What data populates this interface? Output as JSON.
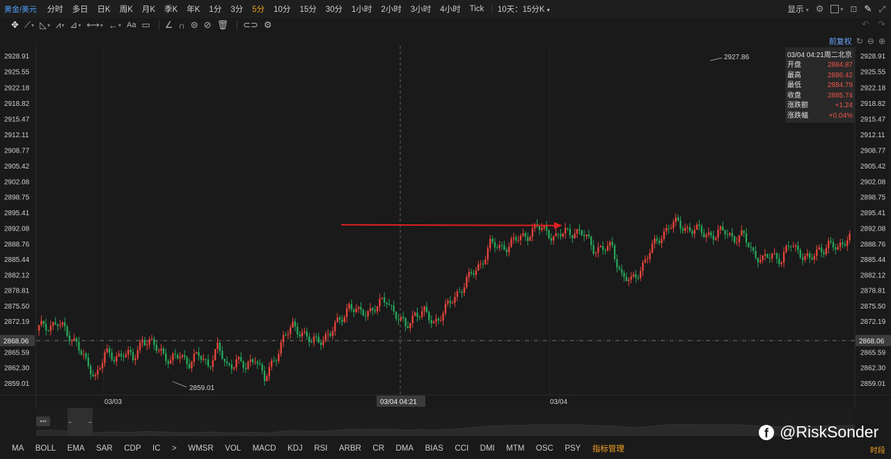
{
  "topbar": {
    "symbol": "黄金/美元",
    "periods": [
      "分时",
      "多日",
      "日K",
      "周K",
      "月K",
      "季K",
      "年K",
      "1分",
      "3分",
      "5分",
      "10分",
      "15分",
      "30分",
      "1小时",
      "2小时",
      "3小时",
      "4小时",
      "Tick"
    ],
    "active_period": "5分",
    "multi_view": "10天：15分K",
    "display_label": "显示"
  },
  "chart_header": {
    "fq_label": "前复权"
  },
  "info_box": {
    "datetime": "03/04 04:21周二北京",
    "rows": [
      {
        "k": "开盘",
        "v": "2884.87"
      },
      {
        "k": "最高",
        "v": "2886.42"
      },
      {
        "k": "最低",
        "v": "2884.79"
      },
      {
        "k": "收盘",
        "v": "2885.74"
      },
      {
        "k": "涨跌额",
        "v": "+1.24"
      },
      {
        "k": "涨跌幅",
        "v": "+0.04%"
      }
    ]
  },
  "chart_data": {
    "type": "candlestick",
    "y_ticks": [
      2928.91,
      2925.55,
      2922.18,
      2918.82,
      2915.47,
      2912.11,
      2908.77,
      2905.42,
      2902.08,
      2898.75,
      2895.41,
      2892.08,
      2888.76,
      2885.44,
      2882.12,
      2878.81,
      2875.5,
      2872.19,
      2868.06,
      2865.59,
      2862.3,
      2859.01
    ],
    "y_tick_labels": [
      "2928.91",
      "2925.55",
      "2922.18",
      "2918.82",
      "2915.47",
      "2912.11",
      "2908.77",
      "2905.42",
      "2902.08",
      "2898.75",
      "2895.41",
      "2892.08",
      "2888.76",
      "2885.44",
      "2882.12",
      "2878.81",
      "2875.50",
      "2872.19",
      "2868.06",
      "2865.59",
      "2862.30",
      "2859.01"
    ],
    "ylim": [
      2856.6,
      2931.0
    ],
    "current_price": "2868.06",
    "x_labels": [
      "03/03",
      "03/04"
    ],
    "crosshair_label": "03/04 04:21",
    "high_marker": "2927.86",
    "low_marker": "2859.01",
    "up_color": "#e8453c",
    "down_color": "#26a65b",
    "bar_count": 173,
    "path_anchors": [
      [
        0,
        2870.8
      ],
      [
        4,
        2871.8
      ],
      [
        6,
        2869.5
      ],
      [
        8,
        2867.8
      ],
      [
        10,
        2863.0
      ],
      [
        12,
        2860.6
      ],
      [
        14,
        2865.0
      ],
      [
        16,
        2864.5
      ],
      [
        18,
        2865.5
      ],
      [
        20,
        2864.0
      ],
      [
        22,
        2868.5
      ],
      [
        24,
        2867.0
      ],
      [
        26,
        2866.0
      ],
      [
        28,
        2863.5
      ],
      [
        30,
        2865.0
      ],
      [
        32,
        2863.5
      ],
      [
        34,
        2864.8
      ],
      [
        36,
        2863.0
      ],
      [
        38,
        2866.5
      ],
      [
        40,
        2862.5
      ],
      [
        42,
        2864.0
      ],
      [
        44,
        2862.0
      ],
      [
        46,
        2865.0
      ],
      [
        48,
        2859.5
      ],
      [
        50,
        2864.0
      ],
      [
        52,
        2868.5
      ],
      [
        54,
        2871.0
      ],
      [
        56,
        2870.0
      ],
      [
        58,
        2867.5
      ],
      [
        60,
        2868.5
      ],
      [
        62,
        2869.5
      ],
      [
        64,
        2872.5
      ],
      [
        66,
        2875.5
      ],
      [
        68,
        2873.8
      ],
      [
        70,
        2874.5
      ],
      [
        72,
        2875.2
      ],
      [
        74,
        2877.0
      ],
      [
        76,
        2873.5
      ],
      [
        78,
        2870.8
      ],
      [
        80,
        2874.0
      ],
      [
        82,
        2873.8
      ],
      [
        84,
        2872.0
      ],
      [
        86,
        2874.0
      ],
      [
        88,
        2876.8
      ],
      [
        90,
        2879.5
      ],
      [
        92,
        2882.0
      ],
      [
        94,
        2884.5
      ],
      [
        96,
        2888.5
      ],
      [
        98,
        2888.0
      ],
      [
        100,
        2888.5
      ],
      [
        102,
        2889.8
      ],
      [
        104,
        2890.8
      ],
      [
        106,
        2892.2
      ],
      [
        108,
        2891.5
      ],
      [
        110,
        2890.0
      ],
      [
        112,
        2891.2
      ],
      [
        114,
        2891.5
      ],
      [
        116,
        2890.5
      ],
      [
        118,
        2888.0
      ],
      [
        120,
        2887.5
      ],
      [
        122,
        2888.0
      ],
      [
        124,
        2882.0
      ],
      [
        126,
        2880.5
      ],
      [
        128,
        2883.5
      ],
      [
        130,
        2887.0
      ],
      [
        132,
        2890.0
      ],
      [
        134,
        2892.5
      ],
      [
        136,
        2893.0
      ],
      [
        138,
        2892.0
      ],
      [
        140,
        2891.5
      ],
      [
        142,
        2891.0
      ],
      [
        144,
        2890.5
      ],
      [
        146,
        2891.5
      ],
      [
        148,
        2890.0
      ],
      [
        150,
        2890.2
      ],
      [
        152,
        2887.0
      ],
      [
        154,
        2885.0
      ],
      [
        156,
        2886.5
      ],
      [
        158,
        2885.5
      ],
      [
        160,
        2888.5
      ],
      [
        162,
        2887.0
      ],
      [
        164,
        2885.0
      ],
      [
        166,
        2887.5
      ],
      [
        168,
        2888.5
      ],
      [
        170,
        2887.5
      ],
      [
        172,
        2890.5
      ]
    ],
    "arrow": {
      "from_price": 2892.8,
      "to_price": 2892.8
    },
    "volume_area": true
  },
  "toolbar": {
    "tools": [
      "move-icon",
      "line-icon",
      "trend-icon",
      "wave-icon",
      "fib-icon",
      "measure-icon",
      "arrow-icon",
      "text-icon",
      "comment-icon",
      "pen-icon",
      "magnet-icon",
      "lock-icon",
      "hide-icon",
      "trash-icon",
      "link-icon",
      "settings-icon"
    ],
    "text_tool": "Aa"
  },
  "indicators": [
    "MA",
    "BOLL",
    "EMA",
    "SAR",
    "CDP",
    "IC",
    ">",
    "WMSR",
    "VOL",
    "MACD",
    "KDJ",
    "RSI",
    "ARBR",
    "CR",
    "DMA",
    "BIAS",
    "CCI",
    "DMI",
    "MTM",
    "OSC",
    "PSY"
  ],
  "indicator_manager": "指标管理",
  "time_segment": "时段",
  "watermark": {
    "handle": "@RiskSonder",
    "icon": "facebook-icon"
  }
}
